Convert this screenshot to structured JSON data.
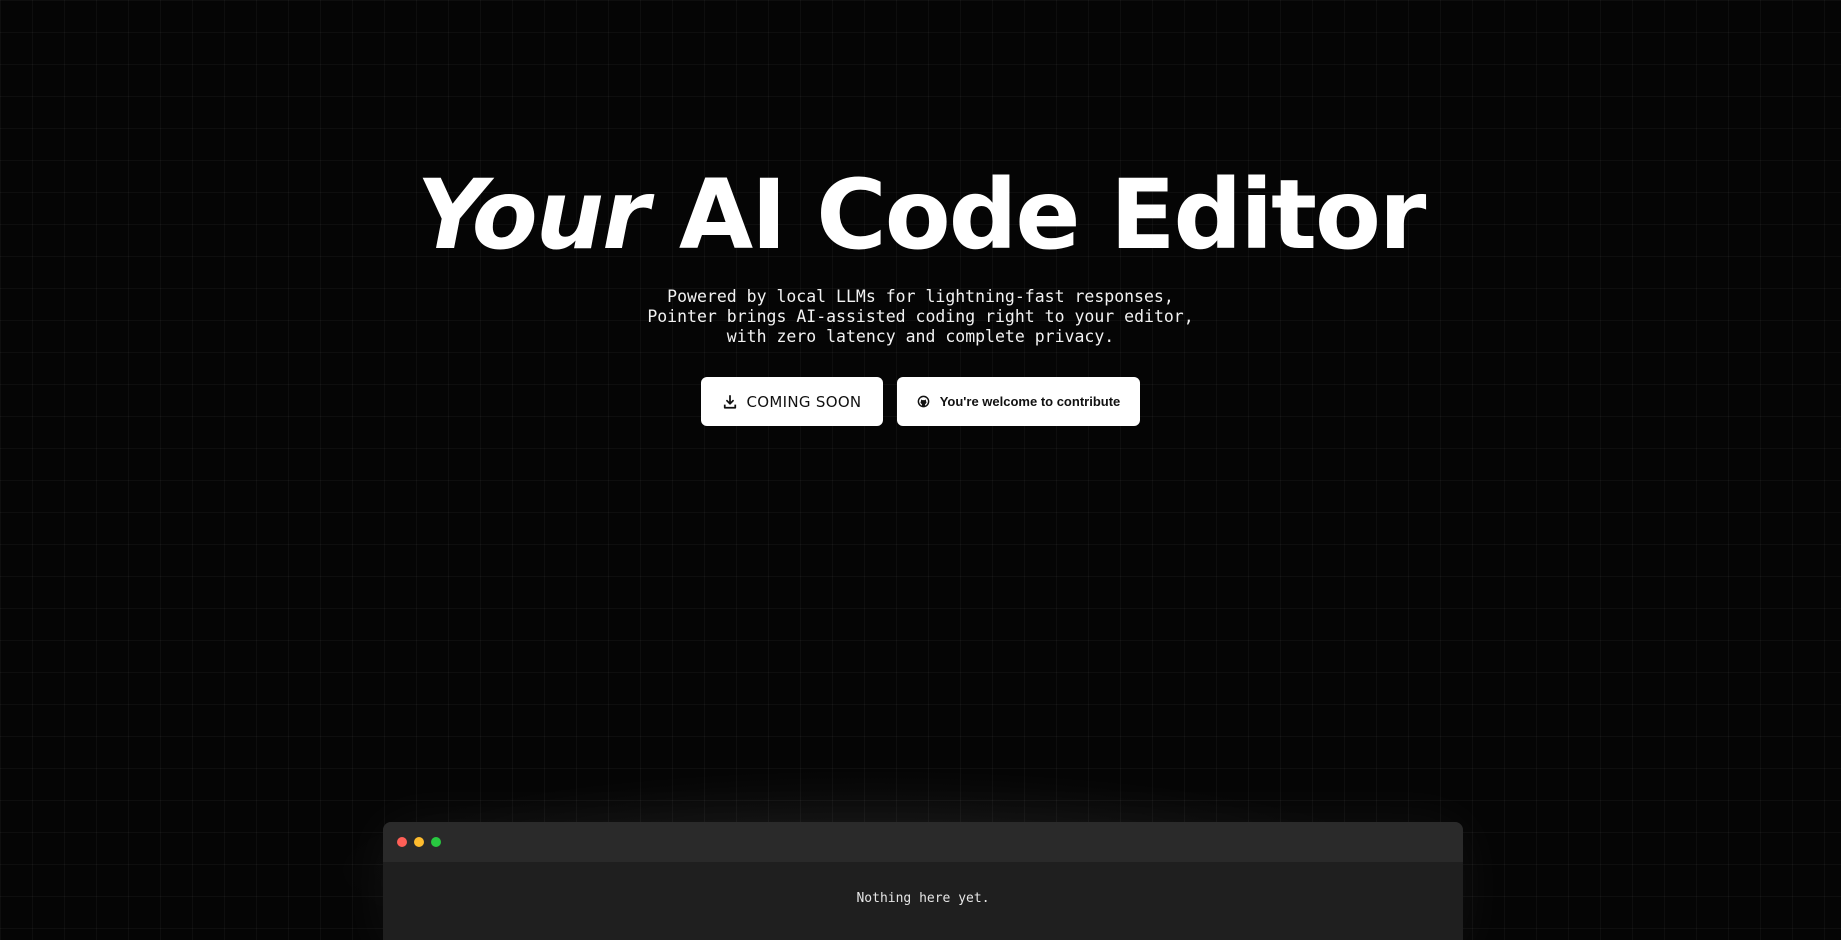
{
  "hero": {
    "headline_italic": "Your",
    "headline_rest": " AI Code Editor",
    "subtitle_lines": [
      "Powered by local LLMs for lightning-fast responses,",
      "Pointer brings AI-assisted coding right to your editor,",
      "with zero latency and complete privacy."
    ]
  },
  "cta": {
    "primary": {
      "label": "COMING SOON",
      "icon": "download-icon"
    },
    "secondary": {
      "label": "You're welcome to contribute",
      "icon": "github-icon"
    }
  },
  "editor_window": {
    "traffic_lights": {
      "close": "#ff5f57",
      "minimize": "#febc2e",
      "maximize": "#28c840"
    },
    "empty_message": "Nothing here yet."
  },
  "colors": {
    "background": "#050505",
    "button_bg": "#ffffff",
    "window_bg": "#1f1f1f",
    "titlebar_bg": "#2a2a2a"
  }
}
